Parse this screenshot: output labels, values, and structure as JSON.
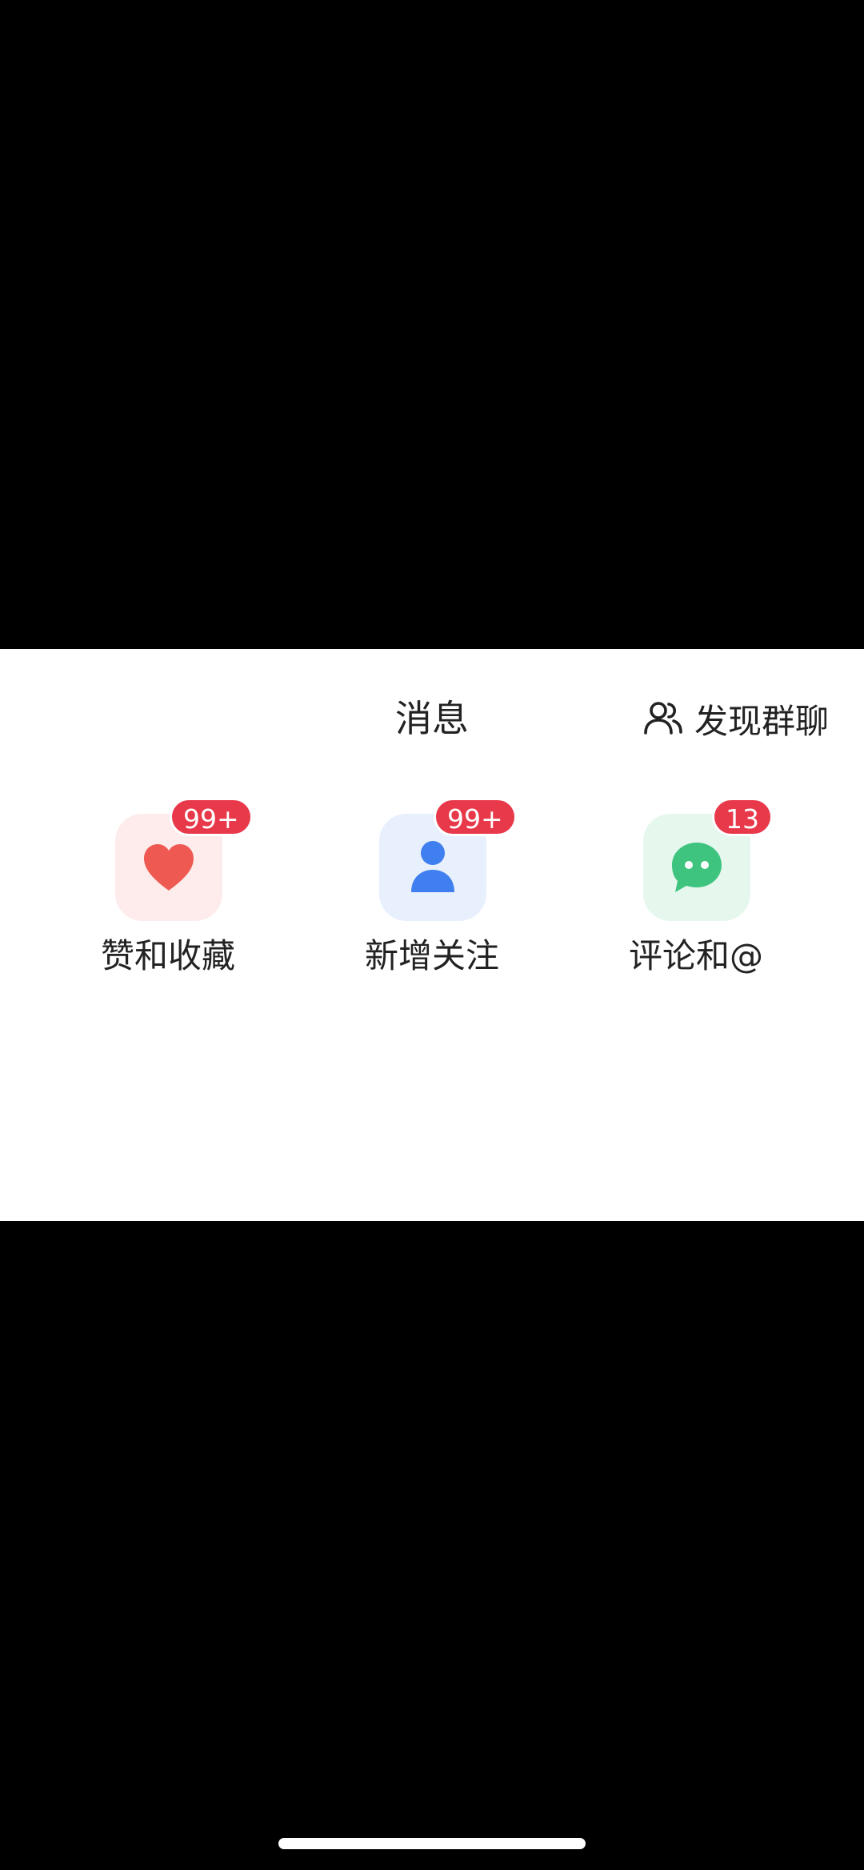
{
  "header": {
    "title": "消息",
    "group_chat_label": "发现群聊"
  },
  "shortcuts": [
    {
      "label": "赞和收藏",
      "badge": "99+",
      "icon": "heart-icon",
      "icon_color": "#ee5a52",
      "bg_color": "#fdeceb"
    },
    {
      "label": "新增关注",
      "badge": "99+",
      "icon": "person-icon",
      "icon_color": "#3f7ff0",
      "bg_color": "#e8effd"
    },
    {
      "label": "评论和@",
      "badge": "13",
      "icon": "chat-bubble-icon",
      "icon_color": "#3ec47f",
      "bg_color": "#e6f7ee"
    }
  ],
  "colors": {
    "badge": "#e8394a",
    "text": "#222222",
    "panel": "#ffffff",
    "backdrop": "#000000"
  }
}
